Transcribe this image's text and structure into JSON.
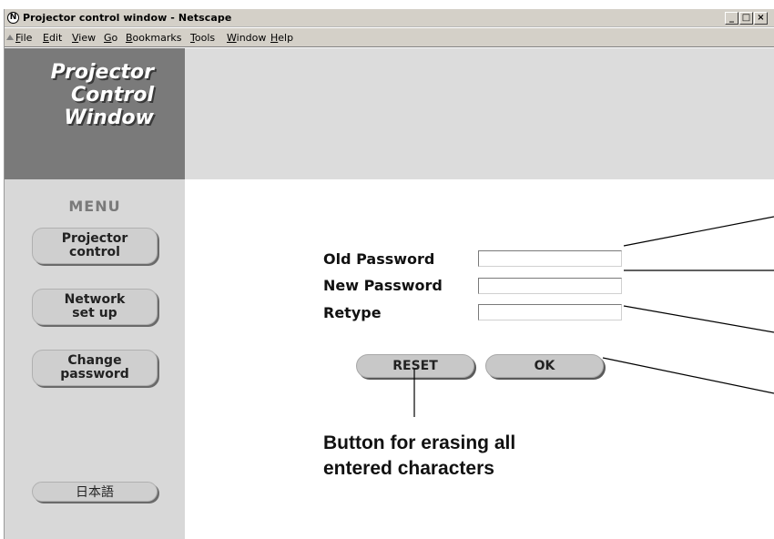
{
  "window": {
    "title": "Projector control window - Netscape",
    "controls": {
      "minimize": "_",
      "maximize": "□",
      "close": "×"
    },
    "app_icon": "netscape-icon"
  },
  "menubar": {
    "items": [
      {
        "label": "File"
      },
      {
        "label": "Edit"
      },
      {
        "label": "View"
      },
      {
        "label": "Go"
      },
      {
        "label": "Bookmarks"
      },
      {
        "label": "Tools"
      },
      {
        "label": "Window"
      },
      {
        "label": "Help"
      }
    ]
  },
  "logo": {
    "lines": [
      "Projector",
      "Control",
      "Window"
    ]
  },
  "sidebar": {
    "title": "MENU",
    "buttons": [
      {
        "label": "Projector\ncontrol"
      },
      {
        "label": "Network\nset up"
      },
      {
        "label": "Change\npassword"
      }
    ],
    "language_button": "日本語"
  },
  "form": {
    "old_password": {
      "label": "Old Password",
      "value": ""
    },
    "new_password": {
      "label": "New Password",
      "value": ""
    },
    "retype": {
      "label": "Retype",
      "value": ""
    }
  },
  "actions": {
    "reset": "RESET",
    "ok": "OK"
  },
  "annotation": {
    "reset_caption_line1": "Button for erasing all",
    "reset_caption_line2": "entered characters"
  },
  "colors": {
    "chrome": "#d4d0c8",
    "banner_left": "#7a7a7a",
    "banner_right": "#dcdcdc",
    "sidebar": "#d8d8d8",
    "button": "#cfcfcf"
  }
}
